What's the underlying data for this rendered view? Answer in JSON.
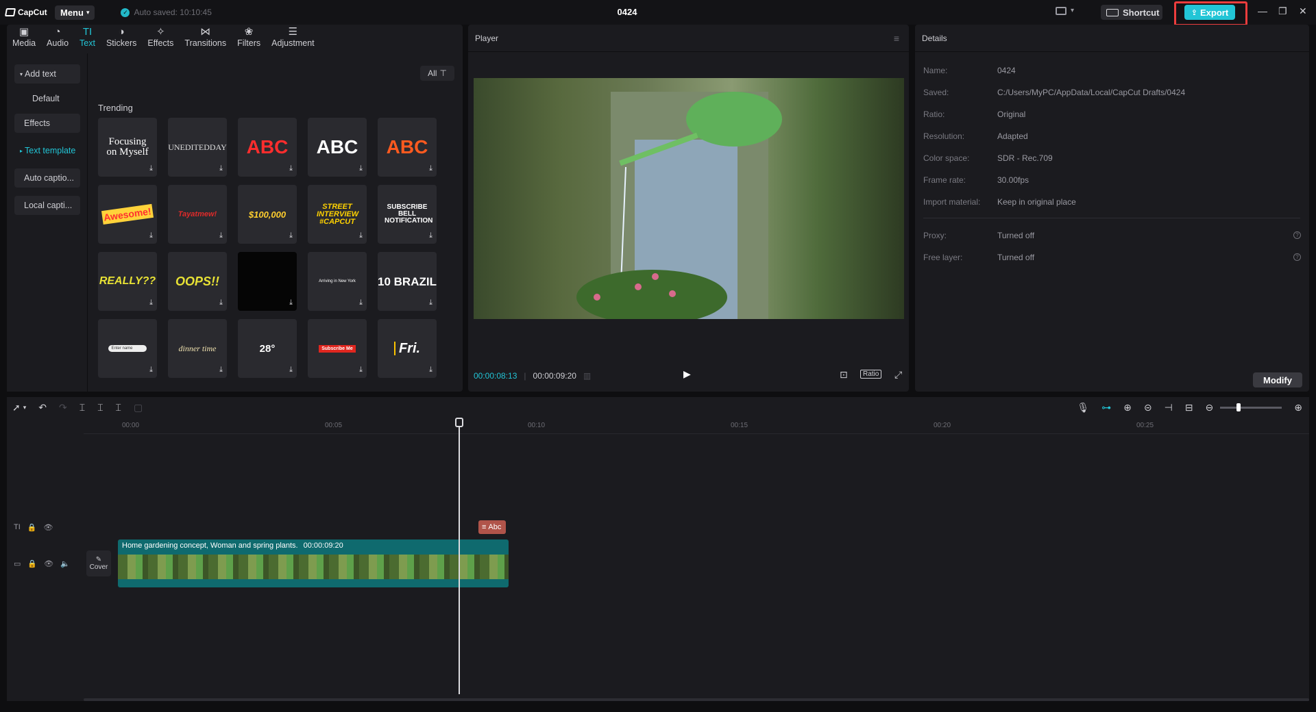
{
  "app": {
    "logo": "CapCut",
    "menu_label": "Menu",
    "autosave": "Auto saved: 10:10:45",
    "project_title": "0424"
  },
  "header": {
    "shortcut_label": "Shortcut",
    "export_label": "Export"
  },
  "tabs": [
    {
      "label": "Media",
      "icon": "media-icon"
    },
    {
      "label": "Audio",
      "icon": "audio-icon"
    },
    {
      "label": "Text",
      "icon": "text-icon",
      "active": true
    },
    {
      "label": "Stickers",
      "icon": "stickers-icon"
    },
    {
      "label": "Effects",
      "icon": "effects-icon"
    },
    {
      "label": "Transitions",
      "icon": "transitions-icon"
    },
    {
      "label": "Filters",
      "icon": "filters-icon"
    },
    {
      "label": "Adjustment",
      "icon": "adjustment-icon"
    }
  ],
  "sidebar": {
    "items": [
      "Add text",
      "Default",
      "Effects",
      "Text template",
      "Auto captio...",
      "Local capti..."
    ]
  },
  "library": {
    "filter_label": "All",
    "section_title": "Trending",
    "tiles": [
      "Focusing on Myself",
      "UNEDITEDDAY",
      "ABC",
      "ABC",
      "ABC",
      "Awesome!",
      "Tayatmew!",
      "$100,000",
      "STREET INTERVIEW #CAPCUT",
      "SUBSCRIBE BELL NOTIFICATION",
      "REALLY??",
      "OOPS!!",
      "",
      "Arriving in New York",
      "10 BRAZIL",
      "Enter name",
      "dinner time",
      "28°",
      "Subscribe Me",
      "Fri."
    ]
  },
  "player": {
    "title": "Player",
    "current_time": "00:00:08:13",
    "total_time": "00:00:09:20",
    "ratio_label": "Ratio"
  },
  "details": {
    "title": "Details",
    "rows": [
      {
        "key": "Name:",
        "value": "0424"
      },
      {
        "key": "Saved:",
        "value": "C:/Users/MyPC/AppData/Local/CapCut Drafts/0424"
      },
      {
        "key": "Ratio:",
        "value": "Original"
      },
      {
        "key": "Resolution:",
        "value": "Adapted"
      },
      {
        "key": "Color space:",
        "value": "SDR - Rec.709"
      },
      {
        "key": "Frame rate:",
        "value": "30.00fps"
      },
      {
        "key": "Import material:",
        "value": "Keep in original place"
      }
    ],
    "rows2": [
      {
        "key": "Proxy:",
        "value": "Turned off"
      },
      {
        "key": "Free layer:",
        "value": "Turned off"
      }
    ],
    "modify_label": "Modify"
  },
  "timeline": {
    "ticks": [
      "00:00",
      "00:05",
      "00:10",
      "00:15",
      "00:20",
      "00:25"
    ],
    "text_clip_label": "Abc",
    "video_clip_title": "Home gardening concept, Woman and spring plants.",
    "video_clip_duration": "00:00:09:20",
    "cover_label": "Cover",
    "text_track_label": "TI"
  },
  "colors": {
    "accent": "#22c5d6",
    "highlight_box": "#ee3d3d",
    "clip": "#0f6a6e",
    "text_clip": "#b0544a"
  }
}
